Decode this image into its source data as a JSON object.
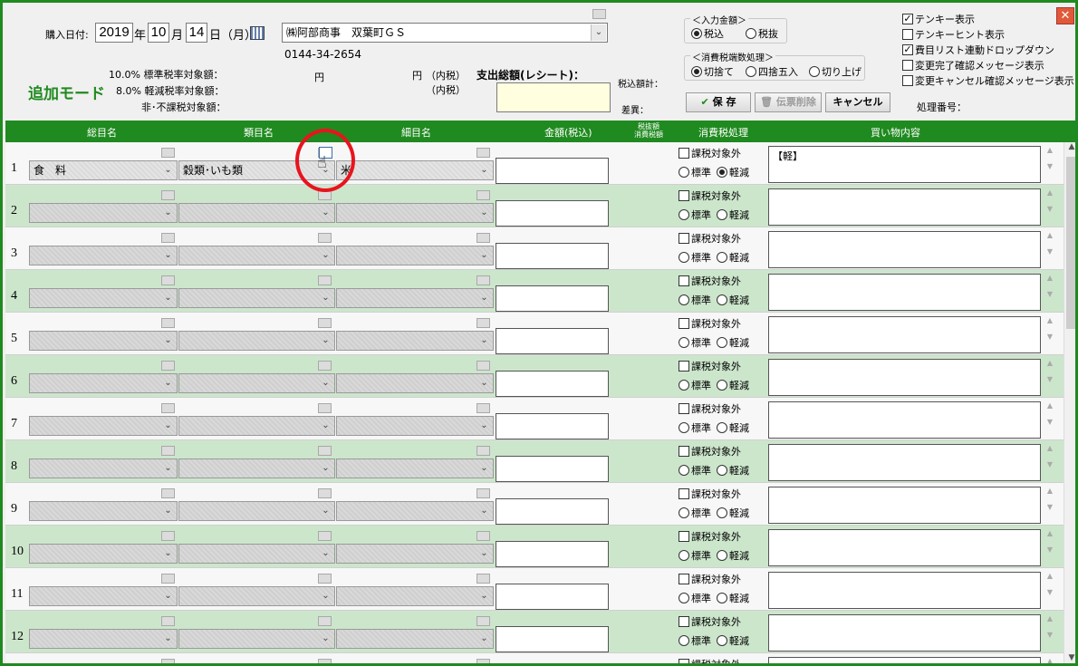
{
  "header": {
    "date_label": "購入日付:",
    "year": "2019",
    "year_unit": "年",
    "month": "10",
    "month_unit": "月",
    "day": "14",
    "day_suffix": "日（月）",
    "shop_name": "㈱阿部商事　双葉町ＧＳ",
    "shop_phone": "0144-34-2654",
    "mode_label": "追加モード",
    "std_rate_label": "10.0% 標準税率対象額：",
    "reduced_rate_label": "8.0% 軽減税率対象額：",
    "nontax_label": "非･不課税対象額：",
    "yen1": "円",
    "yen2": "円",
    "naizei1": "（内税）",
    "naizei2": "（内税）",
    "receipt_total_label": "支出総額(レシート)：",
    "tax_incl_total_label": "税込額計：",
    "diff_label": "差異："
  },
  "input_amount": {
    "title": "＜入力金額＞",
    "options": [
      "税込",
      "税抜"
    ],
    "selected": "税込"
  },
  "rounding": {
    "title": "＜消費税端数処理＞",
    "options": [
      "切捨て",
      "四捨五入",
      "切り上げ"
    ],
    "selected": "切捨て"
  },
  "buttons": {
    "save": "保 存",
    "delete": "伝票削除",
    "cancel": "キャンセル"
  },
  "right_options": [
    {
      "label": "テンキー表示",
      "checked": true
    },
    {
      "label": "テンキーヒント表示",
      "checked": false
    },
    {
      "label": "費目リスト連動ドロップダウン",
      "checked": true
    },
    {
      "label": "変更完了確認メッセージ表示",
      "checked": false
    },
    {
      "label": "変更キャンセル確認メッセージ表示",
      "checked": false
    }
  ],
  "process_no_label": "処理番号：",
  "columns": {
    "general": "総目名",
    "category": "類目名",
    "detail": "細目名",
    "amount": "金額(税込)",
    "tax_excl_line1": "税抜額",
    "tax_excl_line2": "消費税額",
    "tax_treatment": "消費税処理",
    "purchase": "買い物内容"
  },
  "row_labels": {
    "tax_exempt": "課税対象外",
    "standard": "標準",
    "reduced": "軽減"
  },
  "rows": [
    {
      "no": "1",
      "general": "食　料",
      "category": "穀類･いも類",
      "detail": "米",
      "memo": "【軽】",
      "rate": "reduced"
    },
    {
      "no": "2",
      "general": "",
      "category": "",
      "detail": "",
      "memo": "",
      "rate": ""
    },
    {
      "no": "3",
      "general": "",
      "category": "",
      "detail": "",
      "memo": "",
      "rate": ""
    },
    {
      "no": "4",
      "general": "",
      "category": "",
      "detail": "",
      "memo": "",
      "rate": ""
    },
    {
      "no": "5",
      "general": "",
      "category": "",
      "detail": "",
      "memo": "",
      "rate": ""
    },
    {
      "no": "6",
      "general": "",
      "category": "",
      "detail": "",
      "memo": "",
      "rate": ""
    },
    {
      "no": "7",
      "general": "",
      "category": "",
      "detail": "",
      "memo": "",
      "rate": ""
    },
    {
      "no": "8",
      "general": "",
      "category": "",
      "detail": "",
      "memo": "",
      "rate": ""
    },
    {
      "no": "9",
      "general": "",
      "category": "",
      "detail": "",
      "memo": "",
      "rate": ""
    },
    {
      "no": "10",
      "general": "",
      "category": "",
      "detail": "",
      "memo": "",
      "rate": ""
    },
    {
      "no": "11",
      "general": "",
      "category": "",
      "detail": "",
      "memo": "",
      "rate": ""
    },
    {
      "no": "12",
      "general": "",
      "category": "",
      "detail": "",
      "memo": "",
      "rate": ""
    },
    {
      "no": "",
      "general": "",
      "category": "",
      "detail": "",
      "memo": "",
      "rate": ""
    }
  ],
  "icons": {
    "calendar": "calendar-icon",
    "close": "close-icon",
    "save": "checkmark-icon",
    "delete": "trash-icon",
    "cursor": "hand-cursor-icon"
  },
  "colors": {
    "accent_green": "#1f8a1f",
    "row_alt": "#cce6cc",
    "highlight_red": "#e8141d",
    "receipt_yellow": "#ffffe0"
  }
}
